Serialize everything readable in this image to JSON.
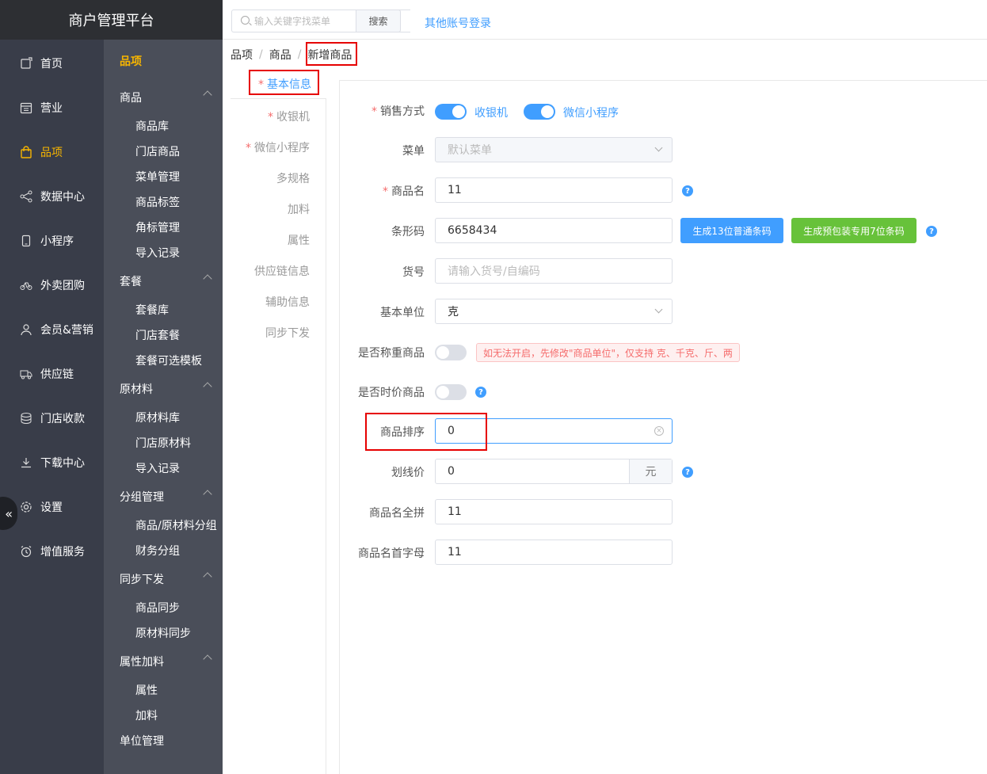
{
  "brand": "商户管理平台",
  "nav": {
    "items": [
      {
        "label": "首页",
        "icon": "home-icon"
      },
      {
        "label": "营业",
        "icon": "calendar-icon"
      },
      {
        "label": "品项",
        "icon": "bag-icon"
      },
      {
        "label": "数据中心",
        "icon": "share-icon"
      },
      {
        "label": "小程序",
        "icon": "phone-icon"
      },
      {
        "label": "外卖团购",
        "icon": "bike-icon"
      },
      {
        "label": "会员&营销",
        "icon": "user-icon"
      },
      {
        "label": "供应链",
        "icon": "truck-icon"
      },
      {
        "label": "门店收款",
        "icon": "coins-icon"
      },
      {
        "label": "下载中心",
        "icon": "download-icon"
      },
      {
        "label": "设置",
        "icon": "gear-icon"
      },
      {
        "label": "增值服务",
        "icon": "alarm-icon"
      }
    ],
    "active_index": 2
  },
  "subnav": {
    "title": "品项",
    "groups": [
      {
        "label": "商品",
        "links": [
          "商品库",
          "门店商品",
          "菜单管理",
          "商品标签",
          "角标管理",
          "导入记录"
        ]
      },
      {
        "label": "套餐",
        "links": [
          "套餐库",
          "门店套餐",
          "套餐可选模板"
        ]
      },
      {
        "label": "原材料",
        "links": [
          "原材料库",
          "门店原材料",
          "导入记录"
        ]
      },
      {
        "label": "分组管理",
        "links": [
          "商品/原材料分组",
          "财务分组"
        ]
      },
      {
        "label": "同步下发",
        "links": [
          "商品同步",
          "原材料同步"
        ]
      },
      {
        "label": "属性加料",
        "links": [
          "属性",
          "加料"
        ]
      }
    ],
    "last": "单位管理"
  },
  "topbar": {
    "search_placeholder": "输入关键字找菜单",
    "search_button": "搜索",
    "other_login": "其他账号登录"
  },
  "breadcrumb": [
    "品项",
    "商品",
    "新增商品"
  ],
  "breadcrumb_sep": "/",
  "section_tabs": {
    "active": "基本信息",
    "items": [
      {
        "label": "收银机",
        "required": true
      },
      {
        "label": "微信小程序",
        "required": true
      },
      {
        "label": "多规格",
        "required": false
      },
      {
        "label": "加料",
        "required": false
      },
      {
        "label": "属性",
        "required": false
      },
      {
        "label": "供应链信息",
        "required": false
      },
      {
        "label": "辅助信息",
        "required": false
      },
      {
        "label": "同步下发",
        "required": false
      }
    ]
  },
  "form": {
    "sale_mode": {
      "label": "销售方式",
      "pos_label": "收银机",
      "pos_on": true,
      "mini_label": "微信小程序",
      "mini_on": true
    },
    "menu": {
      "label": "菜单",
      "value": "默认菜单"
    },
    "name": {
      "label": "商品名",
      "value": "11"
    },
    "barcode": {
      "label": "条形码",
      "value": "6658434",
      "btn13": "生成13位普通条码",
      "btn7": "生成预包装专用7位条码"
    },
    "item_no": {
      "label": "货号",
      "placeholder": "请输入货号/自编码"
    },
    "unit": {
      "label": "基本单位",
      "value": "克"
    },
    "weighed": {
      "label": "是否称重商品",
      "on": false,
      "hint": "如无法开启，先修改\"商品单位\"，仅支持 克、千克、斤、两"
    },
    "market_price": {
      "label": "是否时价商品",
      "on": false
    },
    "sort": {
      "label": "商品排序",
      "value": "0"
    },
    "strike_price": {
      "label": "划线价",
      "value": "0",
      "unit": "元"
    },
    "pinyin_full": {
      "label": "商品名全拼",
      "value": "11"
    },
    "pinyin_initial": {
      "label": "商品名首字母",
      "value": "11"
    }
  },
  "colors": {
    "accent": "#409eff",
    "nav_active": "#f7b500",
    "highlight_box": "#e60000",
    "green": "#67c23a"
  }
}
